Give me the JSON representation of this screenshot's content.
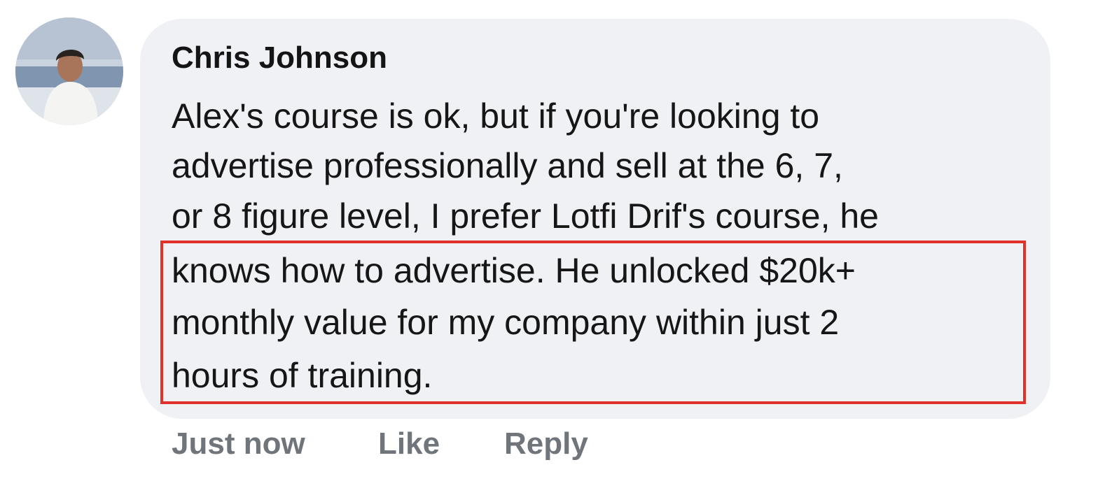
{
  "comment": {
    "author": "Chris Johnson",
    "lines": [
      "Alex's course is ok, but if you're looking to",
      "advertise professionally and sell at the 6, 7,",
      "or 8 figure level, I prefer Lotfi Drif's course, he",
      "knows how to advertise. He unlocked $20k+",
      "monthly value for my company within just 2",
      "hours of training."
    ],
    "actions": {
      "timestamp": "Just now",
      "like": "Like",
      "reply": "Reply"
    }
  },
  "colors": {
    "bubble": "#f0f1f5",
    "highlight": "#e0312b",
    "action_text": "#70757b"
  }
}
